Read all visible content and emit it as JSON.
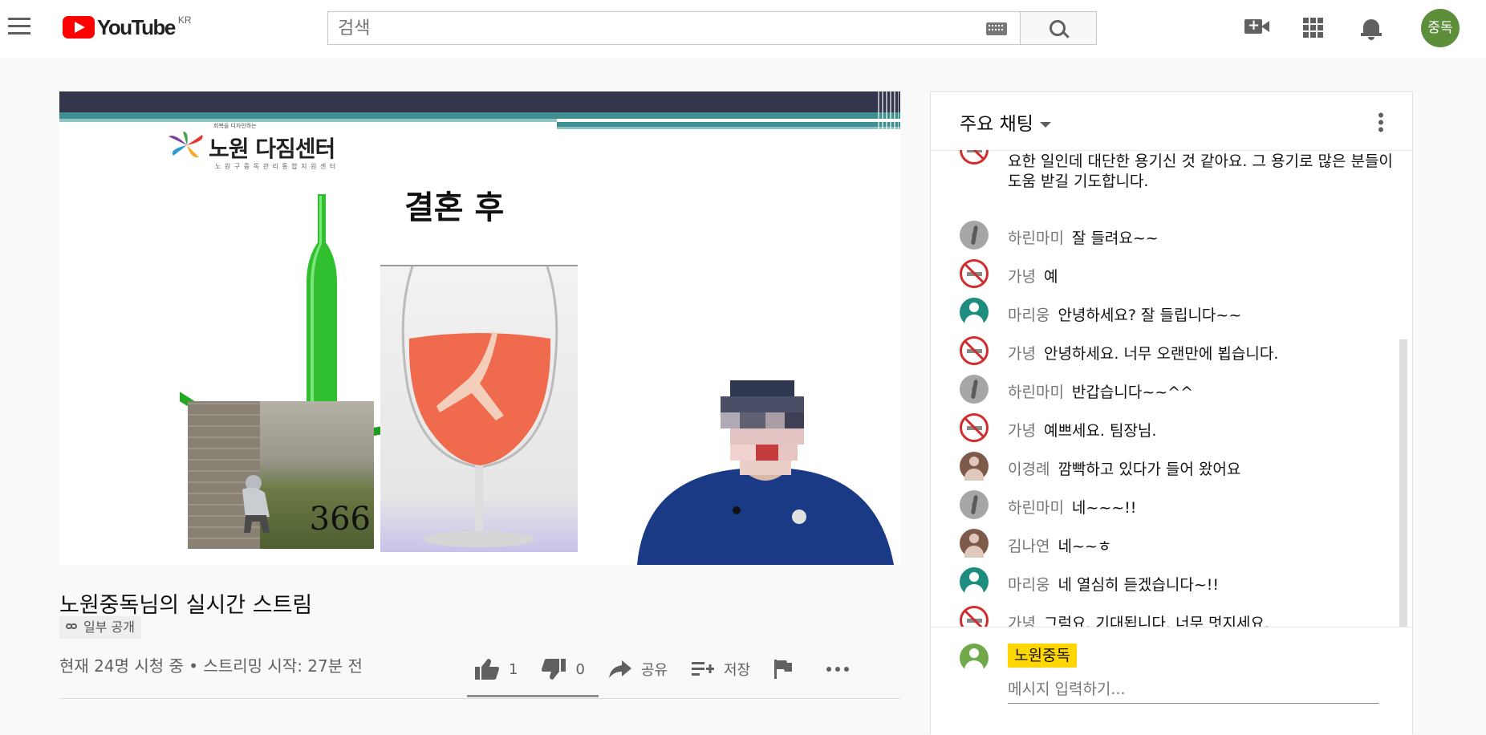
{
  "header": {
    "logo_text": "YouTube",
    "country": "KR",
    "search_placeholder": "검색",
    "user_initial": "중독"
  },
  "video": {
    "slide": {
      "org_small": "회복을 디자인하는",
      "org_name": "노원 다짐센터",
      "org_sub": "노 원 구 중 독 관 리 통 합 지 원 센 터",
      "title": "결혼 후",
      "number_in_photo": "366"
    },
    "title": "노원중독님의 실시간 스트림",
    "privacy": "일부 공개",
    "views": "현재 24명 시청 중 • 스트리밍 시작: 27분 전",
    "likes": "1",
    "dislikes": "0",
    "share_label": "공유",
    "save_label": "저장",
    "like_ratio": 1.0
  },
  "chat": {
    "title": "주요 채팅",
    "partial_message": "요한 일인데 대단한 용기신 것 같아요. 그 용기로 많은 분들이 도움 받길 기도합니다.",
    "messages": [
      {
        "author": "하린마미",
        "text": "잘 들려요~~",
        "avatar": "grey"
      },
      {
        "author": "가녕",
        "text": "예",
        "avatar": "nosmoke"
      },
      {
        "author": "마리웅",
        "text": "안녕하세요? 잘 들립니다~~",
        "avatar": "teal"
      },
      {
        "author": "가녕",
        "text": "안녕하세요. 너무 오랜만에 뵙습니다.",
        "avatar": "nosmoke"
      },
      {
        "author": "하린마미",
        "text": "반갑습니다~~^^",
        "avatar": "grey"
      },
      {
        "author": "가녕",
        "text": "예쁘세요. 팀장님.",
        "avatar": "nosmoke"
      },
      {
        "author": "이경례",
        "text": "깜빡하고 있다가 들어 왔어요",
        "avatar": "brown"
      },
      {
        "author": "하린마미",
        "text": "네~~~!!",
        "avatar": "grey"
      },
      {
        "author": "김나연",
        "text": "네~~ㅎ",
        "avatar": "brown"
      },
      {
        "author": "마리웅",
        "text": "네 열심히 듣겠습니다~!!",
        "avatar": "teal"
      },
      {
        "author": "가녕",
        "text": "그럼요. 기대됩니다. 너무 멋지세요.",
        "avatar": "nosmoke"
      }
    ],
    "composer_name": "노원중독",
    "composer_placeholder": "메시지 입력하기..."
  }
}
